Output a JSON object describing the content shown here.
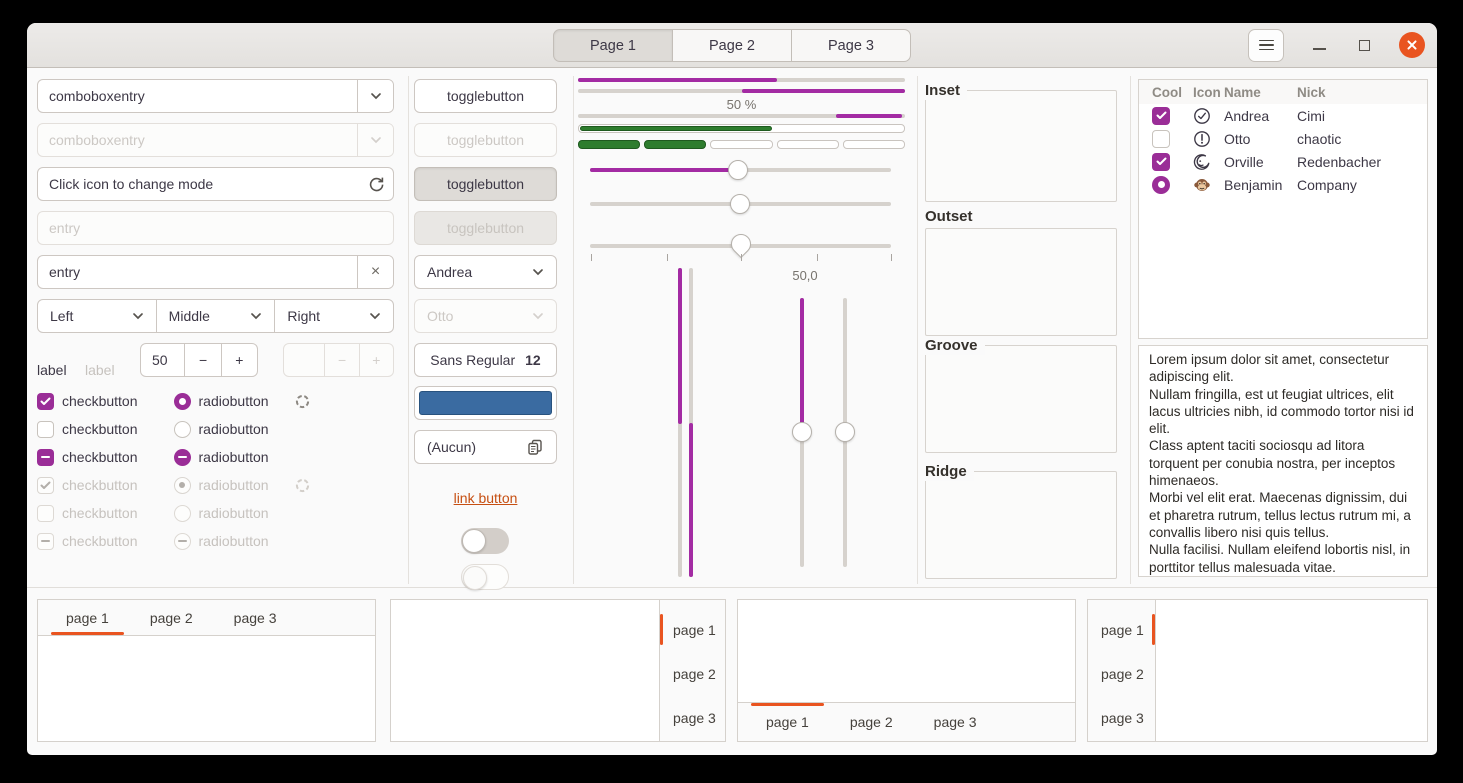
{
  "colors": {
    "accent_purple": "#9a2d97",
    "accent_orange": "#e95420",
    "levelbar_green": "#2e7d2e",
    "color_button_blue": "#3a6ba1",
    "link_orange": "#c64f12"
  },
  "header": {
    "pages": [
      {
        "label": "Page 1",
        "active": true
      },
      {
        "label": "Page 2",
        "active": false
      },
      {
        "label": "Page 3",
        "active": false
      }
    ],
    "icons": [
      "hamburger-icon",
      "minimize-icon",
      "maximize-icon",
      "close-icon"
    ]
  },
  "left": {
    "comboboxentry": {
      "value": "comboboxentry"
    },
    "comboboxentry_disabled": {
      "placeholder": "comboboxentry"
    },
    "mode_entry": {
      "value": "Click icon to change mode",
      "icon": "refresh-icon"
    },
    "entry_disabled": {
      "placeholder": "entry"
    },
    "entry_clear": {
      "value": "entry",
      "icon": "clear-icon"
    },
    "position_combos": [
      {
        "value": "Left"
      },
      {
        "value": "Middle"
      },
      {
        "value": "Right"
      }
    ],
    "label_normal": "label",
    "label_disabled": "label",
    "spinbutton": {
      "value": "50",
      "dec": "−",
      "inc": "+"
    },
    "spinbutton_disabled": {
      "value": "",
      "dec": "−",
      "inc": "+"
    },
    "check_rows": [
      {
        "check_label": "checkbutton",
        "check_state": "checked",
        "radio_label": "radiobutton",
        "radio_state": "selected",
        "spinner": true,
        "disabled": false
      },
      {
        "check_label": "checkbutton",
        "check_state": "unchecked",
        "radio_label": "radiobutton",
        "radio_state": "unselected",
        "spinner": false,
        "disabled": false
      },
      {
        "check_label": "checkbutton",
        "check_state": "mixed",
        "radio_label": "radiobutton",
        "radio_state": "mixed",
        "spinner": false,
        "disabled": false
      },
      {
        "check_label": "checkbutton",
        "check_state": "checked",
        "radio_label": "radiobutton",
        "radio_state": "selected",
        "spinner": true,
        "disabled": true
      },
      {
        "check_label": "checkbutton",
        "check_state": "unchecked",
        "radio_label": "radiobutton",
        "radio_state": "unselected",
        "spinner": false,
        "disabled": true
      },
      {
        "check_label": "checkbutton",
        "check_state": "mixed",
        "radio_label": "radiobutton",
        "radio_state": "mixed",
        "spinner": false,
        "disabled": true
      }
    ]
  },
  "middle": {
    "togglebuttons": [
      {
        "label": "togglebutton",
        "state": "normal"
      },
      {
        "label": "togglebutton",
        "state": "disabled"
      },
      {
        "label": "togglebutton",
        "state": "active"
      },
      {
        "label": "togglebutton",
        "state": "active-disabled"
      }
    ],
    "combo": {
      "value": "Andrea"
    },
    "combo_disabled": {
      "value": "Otto"
    },
    "font_button": {
      "family": "Sans Regular",
      "size": "12"
    },
    "file_button": {
      "value": "(Aucun)",
      "icon": "paste-icon"
    },
    "link_button": "link button",
    "switches": [
      {
        "state": "off"
      },
      {
        "state": "off-disabled"
      }
    ]
  },
  "scales": {
    "progress1_percent": 61,
    "progress2_percent_right": 50,
    "progress_label": "50 %",
    "progress3_segment": [
      79,
      99
    ],
    "levelbar_percent": 59,
    "levelbar_segments_filled": 2,
    "levelbar_segments_total": 5,
    "hscale1_percent": 49,
    "hscale2_percent": 50,
    "hscale3_percent": 50,
    "hscale3_marks": [
      4,
      27,
      50,
      73,
      96
    ],
    "vprogress1_percent": 50,
    "vprogress2_percent_bottom": 50,
    "vscale_label": "50,0",
    "vscale1_percent": 50,
    "vscale2_percent": 50
  },
  "frames": [
    {
      "label": "Inset"
    },
    {
      "label": "Outset"
    },
    {
      "label": "Groove"
    },
    {
      "label": "Ridge"
    }
  ],
  "table": {
    "columns": [
      "Cool",
      "Icon",
      "Name",
      "Nick"
    ],
    "rows": [
      {
        "cool": "checked",
        "icon": "check-circle-icon",
        "name": "Andrea",
        "nick": "Cimi"
      },
      {
        "cool": "unchecked",
        "icon": "alert-circle-icon",
        "name": "Otto",
        "nick": "chaotic"
      },
      {
        "cool": "checked",
        "icon": "moon-face-icon",
        "name": "Orville",
        "nick": "Redenbacher"
      },
      {
        "cool": "radio-selected",
        "icon": "monkey-face-icon",
        "name": "Benjamin",
        "nick": "Company"
      }
    ]
  },
  "textview": {
    "lines": [
      "Lorem ipsum dolor sit amet, consectetur adipiscing elit.",
      "Nullam fringilla, est ut feugiat ultrices, elit lacus ultricies nibh, id commodo tortor nisi id elit.",
      "Class aptent taciti sociosqu ad litora torquent per conubia nostra, per inceptos himenaeos.",
      "Morbi vel elit erat. Maecenas dignissim, dui et pharetra rutrum, tellus lectus rutrum mi, a convallis libero nisi quis tellus.",
      "Nulla facilisi. Nullam eleifend lobortis nisl, in porttitor tellus malesuada vitae."
    ]
  },
  "notebooks": [
    {
      "tabs_position": "top",
      "tabs": [
        "page 1",
        "page 2",
        "page 3"
      ],
      "active_tab": "page 1"
    },
    {
      "tabs_position": "right",
      "tabs": [
        "page 1",
        "page 2",
        "page 3"
      ],
      "active_tab": "page 1"
    },
    {
      "tabs_position": "bottom",
      "tabs": [
        "page 1",
        "page 2",
        "page 3"
      ],
      "active_tab": "page 1"
    },
    {
      "tabs_position": "left",
      "tabs": [
        "page 1",
        "page 2",
        "page 3"
      ],
      "active_tab": "page 1"
    }
  ]
}
